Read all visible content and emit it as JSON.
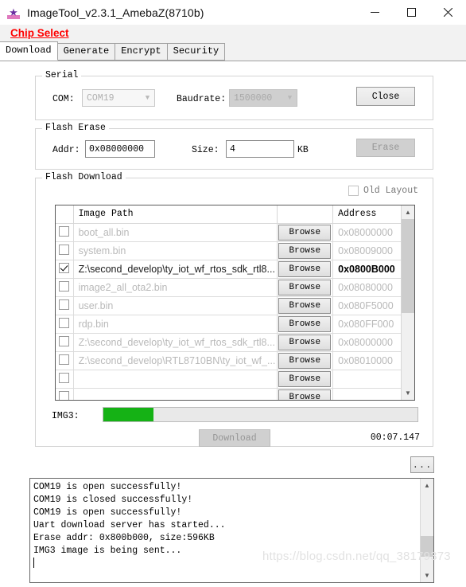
{
  "window": {
    "title": "ImageTool_v2.3.1_AmebaZ(8710b)",
    "icon": "app-logo-icon",
    "controls": {
      "minimize": "minimize-icon",
      "maximize": "maximize-icon",
      "close": "close-icon"
    }
  },
  "menu": {
    "chip_select": "Chip Select"
  },
  "tabs": [
    {
      "label": "Download",
      "active": true
    },
    {
      "label": "Generate",
      "active": false
    },
    {
      "label": "Encrypt",
      "active": false
    },
    {
      "label": "Security",
      "active": false
    }
  ],
  "serial": {
    "group_title": "Serial",
    "com_label": "COM:",
    "com_value": "COM19",
    "baudrate_label": "Baudrate:",
    "baudrate_value": "1500000",
    "close_button": "Close"
  },
  "flash_erase": {
    "group_title": "Flash Erase",
    "addr_label": "Addr:",
    "addr_value": "0x08000000",
    "size_label": "Size:",
    "size_value": "4",
    "size_unit": "KB",
    "erase_button": "Erase"
  },
  "flash_download": {
    "group_title": "Flash Download",
    "old_layout_label": "Old Layout",
    "old_layout_checked": false,
    "columns": {
      "check": "",
      "path": "Image Path",
      "browse": "",
      "address": "Address"
    },
    "browse_label": "Browse",
    "rows": [
      {
        "checked": false,
        "path": "boot_all.bin",
        "address": "0x08000000",
        "enabled": false
      },
      {
        "checked": false,
        "path": "system.bin",
        "address": "0x08009000",
        "enabled": false
      },
      {
        "checked": true,
        "path": "Z:\\second_develop\\ty_iot_wf_rtos_sdk_rtl8...",
        "address": "0x0800B000",
        "enabled": true
      },
      {
        "checked": false,
        "path": "image2_all_ota2.bin",
        "address": "0x08080000",
        "enabled": false
      },
      {
        "checked": false,
        "path": "user.bin",
        "address": "0x080F5000",
        "enabled": false
      },
      {
        "checked": false,
        "path": "rdp.bin",
        "address": "0x080FF000",
        "enabled": false
      },
      {
        "checked": false,
        "path": "Z:\\second_develop\\ty_iot_wf_rtos_sdk_rtl8...",
        "address": "0x08000000",
        "enabled": false
      },
      {
        "checked": false,
        "path": "Z:\\second_develop\\RTL8710BN\\ty_iot_wf_...",
        "address": "0x08010000",
        "enabled": false
      },
      {
        "checked": false,
        "path": "",
        "address": "",
        "enabled": false
      },
      {
        "checked": false,
        "path": "",
        "address": "",
        "enabled": false
      }
    ],
    "progress_label": "IMG3:",
    "progress_percent": 16,
    "download_button": "Download",
    "elapsed_time": "00:07.147"
  },
  "log": {
    "more_button": "...",
    "lines": [
      "COM19 is open successfully!",
      "COM19 is closed successfully!",
      "COM19 is open successfully!",
      "Uart download server has started...",
      "Erase addr: 0x800b000, size:596KB",
      "IMG3 image is being sent..."
    ]
  },
  "watermark": "https://blog.csdn.net/qq_38179373",
  "colors": {
    "chip_select": "#ff0000",
    "progress_fill": "#15b215",
    "window_bg": "#ffffff"
  }
}
